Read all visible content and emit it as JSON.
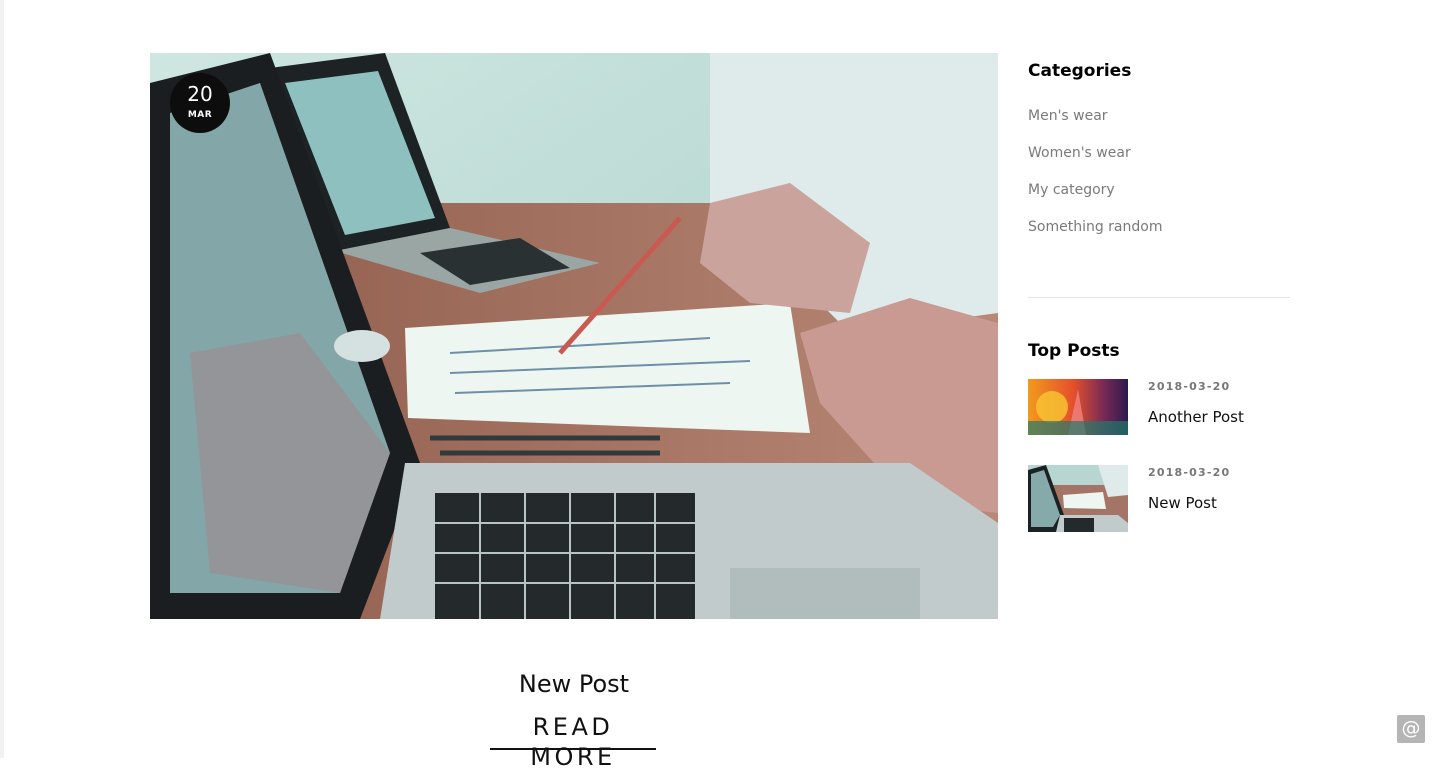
{
  "post": {
    "date_day": "20",
    "date_month": "MAR",
    "title": "New Post",
    "read_more": "READ MORE",
    "image_icon": "laptop-desk-photo"
  },
  "sidebar": {
    "categories_title": "Categories",
    "categories": [
      "Men's wear",
      "Women's wear",
      "My category",
      "Something random"
    ],
    "top_posts_title": "Top Posts",
    "top_posts": [
      {
        "date": "2018-03-20",
        "title": "Another Post",
        "thumb_icon": "abstract-sunset-thumb"
      },
      {
        "date": "2018-03-20",
        "title": "New Post",
        "thumb_icon": "laptop-desk-thumb"
      }
    ]
  },
  "fab": {
    "label": "@",
    "icon": "at-sign-icon"
  }
}
